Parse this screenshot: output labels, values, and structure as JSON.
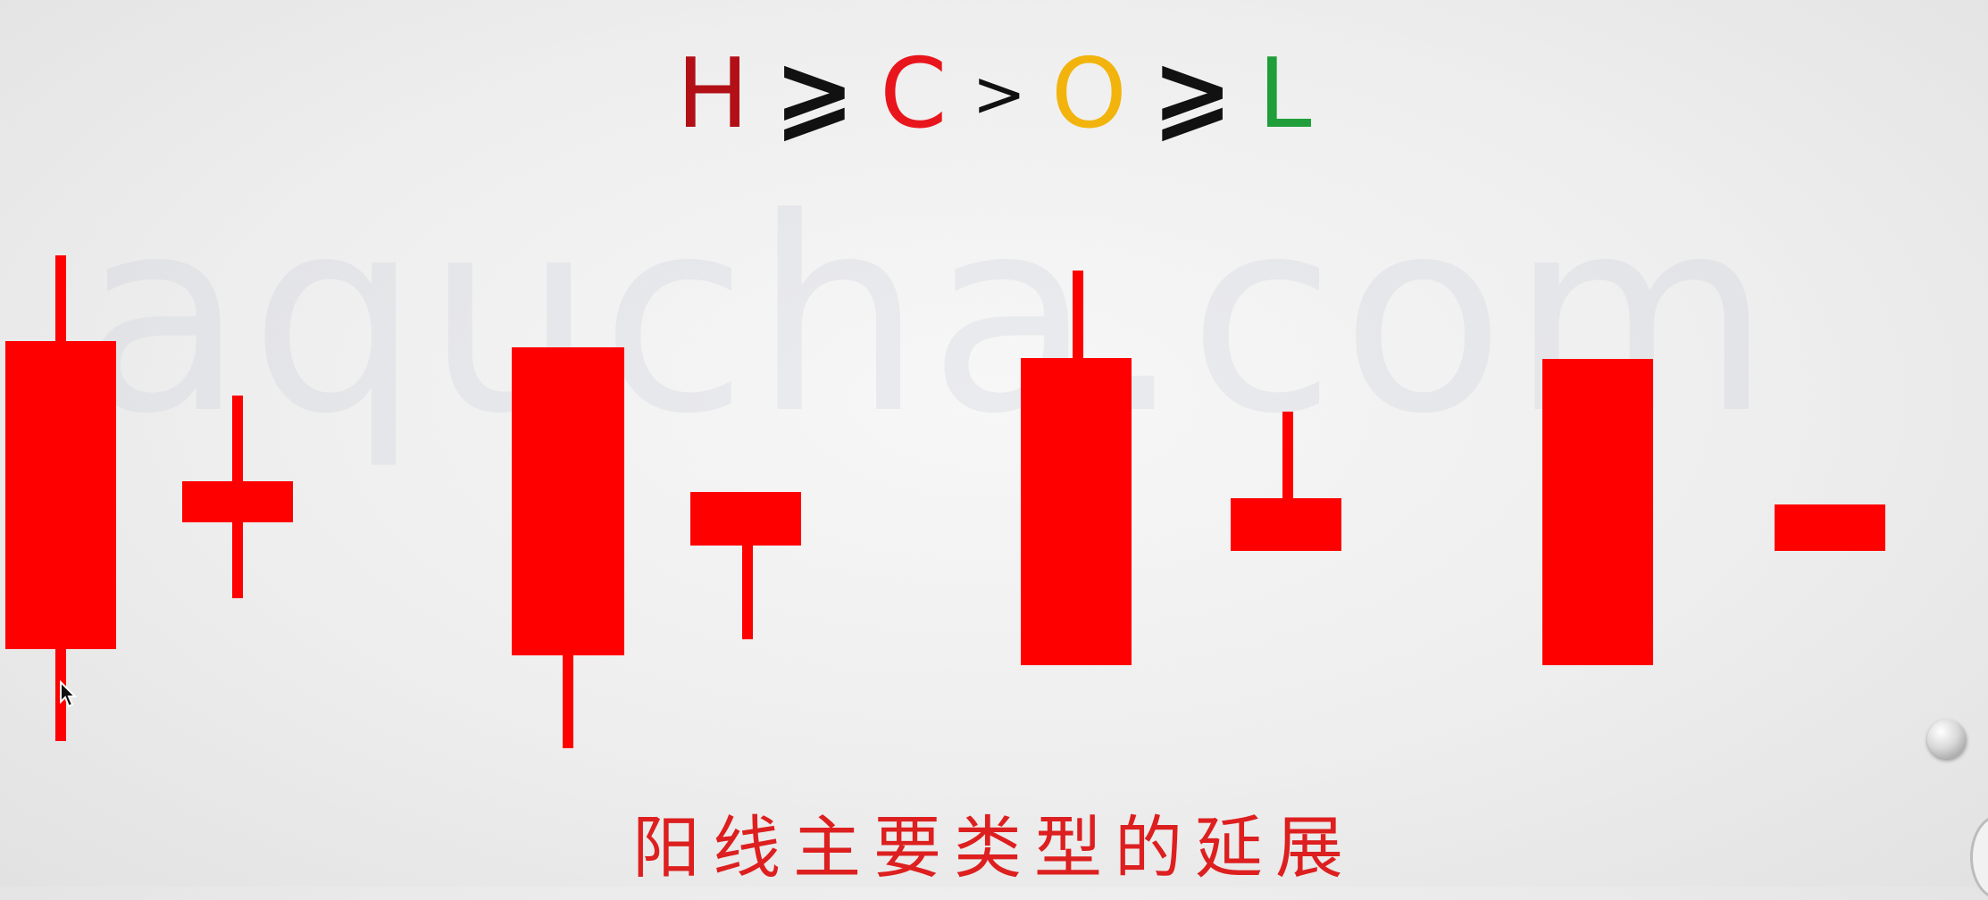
{
  "watermark": "aqucha.com",
  "formula": {
    "high": "H",
    "op1": "⩾",
    "close": "C",
    "op2": ">",
    "open": "O",
    "op3": "⩾",
    "low": "L"
  },
  "colors": {
    "candle": "#ff0000",
    "high": "#b20f17",
    "close": "#e8161c",
    "open": "#f2b40c",
    "low": "#1f9e3a",
    "caption": "#dd1f1f"
  },
  "candles": [
    {
      "type": "long body, upper and lower shadows"
    },
    {
      "type": "short body, upper and lower shadows"
    },
    {
      "type": "long body, lower shadow"
    },
    {
      "type": "short body, lower shadow"
    },
    {
      "type": "long body, upper shadow"
    },
    {
      "type": "short body, upper shadow"
    },
    {
      "type": "long body, no shadows"
    },
    {
      "type": "short body, no shadows"
    }
  ],
  "caption": "阳线主要类型的延展",
  "icons": [
    "mouse-pointer-icon",
    "orb-button-icon"
  ]
}
